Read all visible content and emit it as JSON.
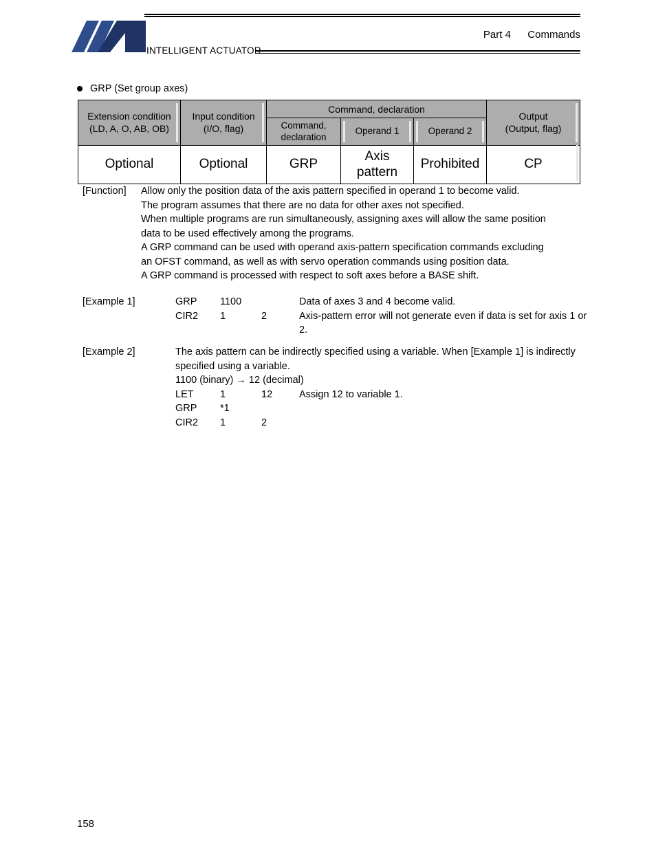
{
  "header": {
    "logo_alt": "ia-logo",
    "logo_caption": "INTELLIGENT ACTUATOR",
    "part": "Part 4",
    "part_section": "Commands"
  },
  "section": {
    "bullet": "●",
    "title": "GRP (Set group axes)"
  },
  "spec_table": {
    "group_header": "Command, declaration",
    "headers": {
      "extension_condition": "Extension condition",
      "extension_condition_sub": "(LD, A, O, AB, OB)",
      "input_condition": "Input condition",
      "input_condition_sub": "(I/O, flag)",
      "command_declaration": "Command,",
      "command_declaration_2": "declaration",
      "operand1": "Operand 1",
      "operand2": "Operand 2",
      "output": "Output",
      "output_sub": "(Output, flag)"
    },
    "values": {
      "extension_condition": "Optional",
      "input_condition": "Optional",
      "command_declaration": "GRP",
      "operand1_line1": "Axis",
      "operand1_line2": "pattern",
      "operand2": "Prohibited",
      "output": "CP"
    }
  },
  "function": {
    "label": "[Function]",
    "lines": [
      "Allow only the position data of the axis pattern specified in operand 1 to become valid.",
      "The program assumes that there are no data for other axes not specified.",
      "When multiple programs are run simultaneously, assigning axes will allow the same position",
      "data to be used effectively among the programs.",
      "A GRP command can be used with operand axis-pattern specification commands excluding",
      "an OFST command, as well as with servo operation commands using position data.",
      "A GRP command is processed with respect to soft axes before a BASE shift."
    ]
  },
  "example1": {
    "label": "[Example 1]",
    "rows": [
      {
        "op": "GRP",
        "arg1": "1100",
        "arg2": "",
        "note": "Data of axes 3 and 4 become valid."
      },
      {
        "op": "CIR2",
        "arg1": "1",
        "arg2": "2",
        "note": "Axis-pattern error will not generate even if data is set for axis 1 or 2."
      }
    ]
  },
  "example2": {
    "label": "[Example 2]",
    "paragraph": "The axis pattern can be indirectly specified using a variable. When [Example 1] is indirectly specified using a variable.",
    "conversion": "1100 (binary) → 12 (decimal)",
    "rows": [
      {
        "op": "LET",
        "arg1": "1",
        "arg2": "12",
        "note": "Assign 12 to variable 1."
      },
      {
        "op": "GRP",
        "arg1": "*1",
        "arg2": "",
        "note": ""
      },
      {
        "op": "CIR2",
        "arg1": "1",
        "arg2": "2",
        "note": ""
      }
    ]
  },
  "footer": {
    "page_number": "158"
  },
  "colors": {
    "header_cell_bg": "#adadad",
    "logo_navy": "#1f3364",
    "logo_blue": "#2f4d8c",
    "text": "#000000"
  }
}
